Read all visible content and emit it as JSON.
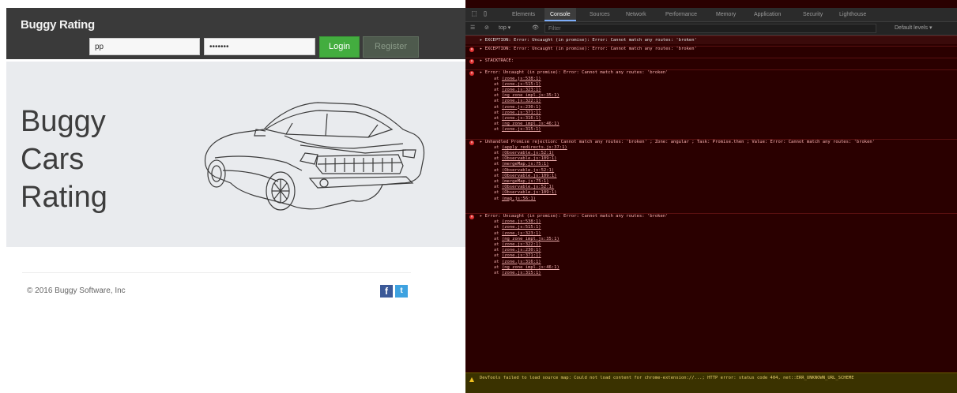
{
  "site": {
    "brand": "Buggy Rating",
    "login_value": "pp",
    "password_value": "•••••••",
    "login_button": "Login",
    "register_button": "Register",
    "hero_line1": "Buggy",
    "hero_line2": "Cars",
    "hero_line3": "Rating",
    "copyright": "© 2016 Buggy Software, Inc",
    "facebook_glyph": "f",
    "twitter_glyph": "t"
  },
  "devtools": {
    "tabs": [
      "Elements",
      "Console",
      "Sources",
      "Network",
      "Performance",
      "Memory",
      "Application",
      "Security",
      "Lighthouse"
    ],
    "active_tab": "Console",
    "context": "top ▾",
    "filter_placeholder": "Filter",
    "levels": "Default levels ▾",
    "exception_line": "▸ EXCEPTION: Error: Uncaught (in promise): Error: Cannot match any routes: 'broken'",
    "messages": [
      {
        "text": "▸ EXCEPTION: Error: Uncaught (in promise): Error: Cannot match any routes: 'broken'",
        "stack": []
      },
      {
        "text": "▸ STACKTRACE:",
        "stack": []
      },
      {
        "text": "▸ Error: Uncaught (in promise): Error: Cannot match any routes: 'broken'",
        "stack": [
          "zone.js:538:1",
          "zone.js:515:1",
          "zone.js:323:1",
          "ng_zone_impl.js:35:1",
          "zone.js:322:1",
          "zone.js:230:1",
          "zone.js:371:1",
          "zone.js:316:1",
          "ng_zone_impl.js:46:1",
          "zone.js:315:1"
        ]
      },
      {
        "text": "▸ Unhandled Promise rejection: Cannot match any routes: 'broken' ; Zone: angular ; Task: Promise.then ; Value: Error: Cannot match any routes: 'broken'",
        "stack": [
          "apply_redirects.js:37:1",
          "Observable.js:52:1",
          "Observable.js:109:1",
          "mergeMap.js:75:1",
          "Observable.js:52:1",
          "Observable.js:109:1",
          "mergeMap.js:75:1",
          "Observable.js:52:1",
          "Observable.js:109:1",
          "map.js:56:1"
        ]
      },
      {
        "text": "▸ Error: Uncaught (in promise): Error: Cannot match any routes: 'broken'",
        "stack": [
          "zone.js:538:1",
          "zone.js:515:1",
          "zone.js:323:1",
          "ng_zone_impl.js:35:1",
          "zone.js:322:1",
          "zone.js:230:1",
          "zone.js:371:1",
          "zone.js:316:1",
          "ng_zone_impl.js:46:1",
          "zone.js:315:1"
        ]
      }
    ],
    "warning": "DevTools failed to load source map: Could not load content for chrome-extension://...; HTTP error: status code 404, net::ERR_UNKNOWN_URL_SCHEME"
  }
}
